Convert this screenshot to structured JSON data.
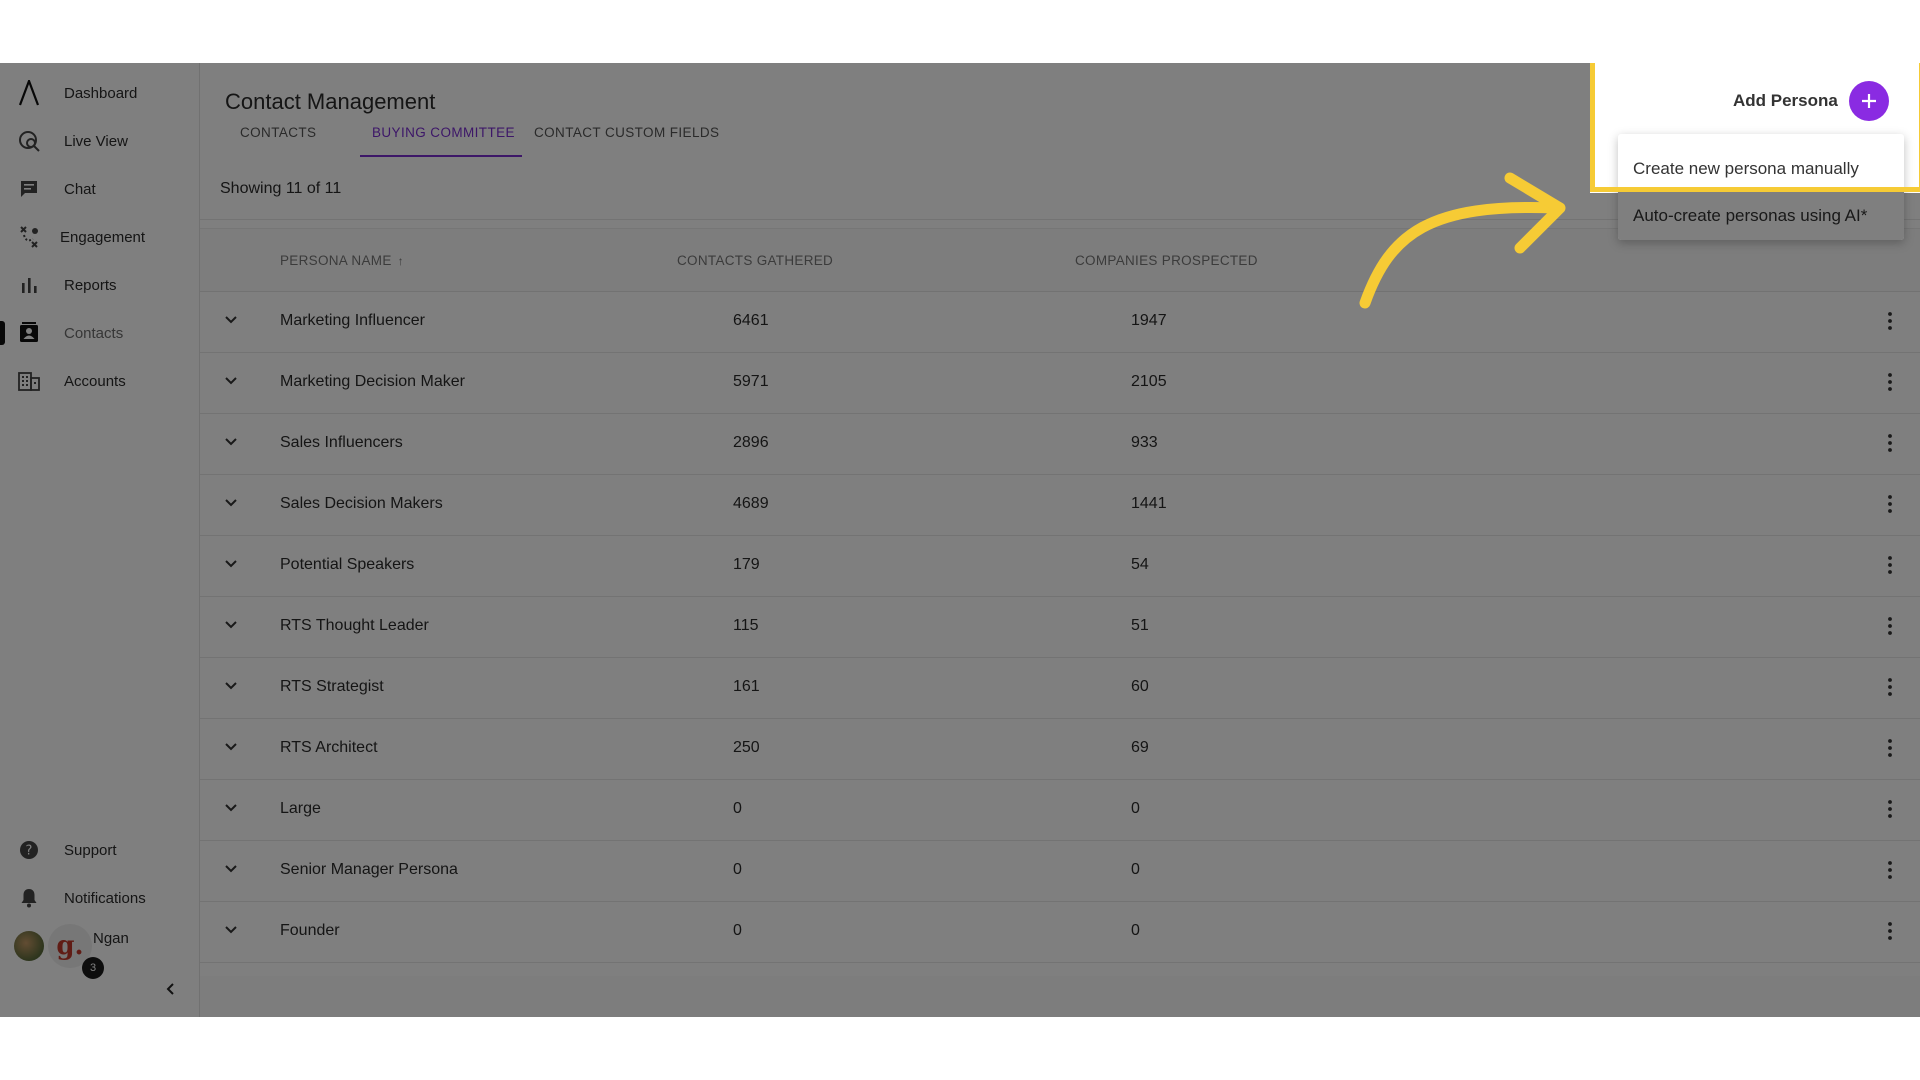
{
  "app": {
    "page_title": "Contact Management"
  },
  "sidebar": {
    "items": [
      {
        "label": "Dashboard",
        "icon": "logo-icon"
      },
      {
        "label": "Live View",
        "icon": "live-view-icon"
      },
      {
        "label": "Chat",
        "icon": "chat-icon"
      },
      {
        "label": "Engagement",
        "icon": "engagement-icon"
      },
      {
        "label": "Reports",
        "icon": "bar-chart-icon"
      },
      {
        "label": "Contacts",
        "icon": "contact-card-icon",
        "active": true
      },
      {
        "label": "Accounts",
        "icon": "building-icon"
      }
    ],
    "bottom_items": [
      {
        "label": "Support",
        "icon": "help-circle-icon"
      },
      {
        "label": "Notifications",
        "icon": "bell-icon"
      }
    ],
    "user": {
      "name": "Ngan",
      "avatar_letter": "g.",
      "notification_count": "3"
    }
  },
  "tabs": [
    {
      "label": "CONTACTS",
      "active": false
    },
    {
      "label": "BUYING COMMITTEE",
      "active": true
    },
    {
      "label": "CONTACT CUSTOM FIELDS",
      "active": false
    }
  ],
  "toolbar": {
    "showing": "Showing 11 of 11",
    "add_persona_label": "Add Persona"
  },
  "menu": {
    "items": [
      "Create new persona manually",
      "Auto-create personas using AI*"
    ]
  },
  "table": {
    "columns": [
      "PERSONA NAME",
      "CONTACTS GATHERED",
      "COMPANIES PROSPECTED"
    ],
    "rows": [
      {
        "name": "Marketing Influencer",
        "contacts": "6461",
        "companies": "1947"
      },
      {
        "name": "Marketing Decision Maker",
        "contacts": "5971",
        "companies": "2105"
      },
      {
        "name": "Sales Influencers",
        "contacts": "2896",
        "companies": "933"
      },
      {
        "name": "Sales Decision Makers",
        "contacts": "4689",
        "companies": "1441"
      },
      {
        "name": "Potential Speakers",
        "contacts": "179",
        "companies": "54"
      },
      {
        "name": "RTS Thought Leader",
        "contacts": "115",
        "companies": "51"
      },
      {
        "name": "RTS Strategist",
        "contacts": "161",
        "companies": "60"
      },
      {
        "name": "RTS Architect",
        "contacts": "250",
        "companies": "69"
      },
      {
        "name": "Large",
        "contacts": "0",
        "companies": "0"
      },
      {
        "name": "Senior Manager Persona",
        "contacts": "0",
        "companies": "0"
      },
      {
        "name": "Founder",
        "contacts": "0",
        "companies": "0"
      }
    ]
  },
  "colors": {
    "accent": "#7b2fd1",
    "add_button": "#8a2be2",
    "highlight": "#f6cb35"
  }
}
